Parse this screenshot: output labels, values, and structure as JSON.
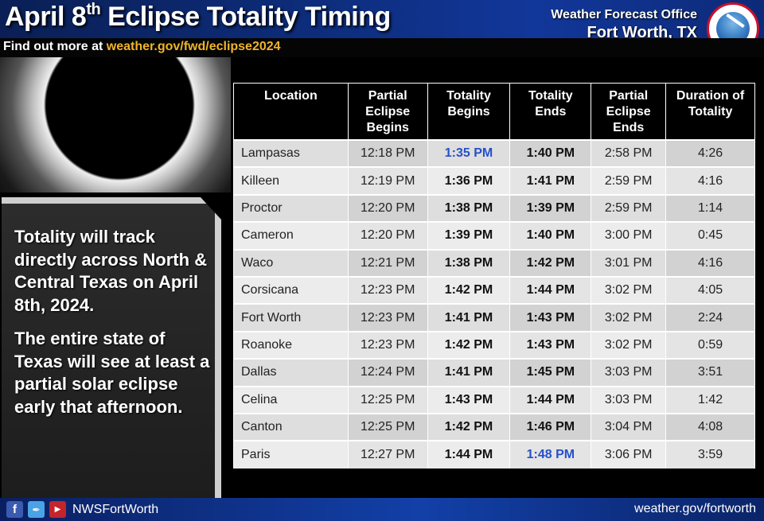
{
  "header": {
    "title_pre": "April 8",
    "title_sup": "th",
    "title_post": " Eclipse Totality Timing",
    "subtitle_prefix": "Find out more at ",
    "subtitle_link": "weather.gov/fwd/eclipse2024",
    "office_line1": "Weather Forecast Office",
    "office_line2": "Fort Worth, TX",
    "logo_icon": "nws-logo-icon"
  },
  "info_panel": {
    "paragraph1": "Totality will track directly across North & Central Texas on April 8th, 2024.",
    "paragraph2": "The entire state of Texas will see at least a partial solar eclipse early that afternoon."
  },
  "table": {
    "columns": [
      "Location",
      "Partial Eclipse Begins",
      "Totality Begins",
      "Totality Ends",
      "Partial Eclipse Ends",
      "Duration of Totality"
    ],
    "highlight_color": "#2550c8",
    "rows": [
      {
        "location": "Lampasas",
        "partial_begins": "12:18 PM",
        "totality_begins": "1:35 PM",
        "totality_ends": "1:40 PM",
        "partial_ends": "2:58 PM",
        "duration": "4:26"
      },
      {
        "location": "Killeen",
        "partial_begins": "12:19 PM",
        "totality_begins": "1:36 PM",
        "totality_ends": "1:41 PM",
        "partial_ends": "2:59 PM",
        "duration": "4:16"
      },
      {
        "location": "Proctor",
        "partial_begins": "12:20 PM",
        "totality_begins": "1:38 PM",
        "totality_ends": "1:39 PM",
        "partial_ends": "2:59 PM",
        "duration": "1:14"
      },
      {
        "location": "Cameron",
        "partial_begins": "12:20 PM",
        "totality_begins": "1:39 PM",
        "totality_ends": "1:40 PM",
        "partial_ends": "3:00 PM",
        "duration": "0:45"
      },
      {
        "location": "Waco",
        "partial_begins": "12:21 PM",
        "totality_begins": "1:38 PM",
        "totality_ends": "1:42 PM",
        "partial_ends": "3:01 PM",
        "duration": "4:16"
      },
      {
        "location": "Corsicana",
        "partial_begins": "12:23 PM",
        "totality_begins": "1:42 PM",
        "totality_ends": "1:44 PM",
        "partial_ends": "3:02 PM",
        "duration": "4:05"
      },
      {
        "location": "Fort Worth",
        "partial_begins": "12:23 PM",
        "totality_begins": "1:41 PM",
        "totality_ends": "1:43 PM",
        "partial_ends": "3:02 PM",
        "duration": "2:24"
      },
      {
        "location": "Roanoke",
        "partial_begins": "12:23 PM",
        "totality_begins": "1:42 PM",
        "totality_ends": "1:43 PM",
        "partial_ends": "3:02 PM",
        "duration": "0:59"
      },
      {
        "location": "Dallas",
        "partial_begins": "12:24 PM",
        "totality_begins": "1:41 PM",
        "totality_ends": "1:45 PM",
        "partial_ends": "3:03 PM",
        "duration": "3:51"
      },
      {
        "location": "Celina",
        "partial_begins": "12:25 PM",
        "totality_begins": "1:43 PM",
        "totality_ends": "1:44 PM",
        "partial_ends": "3:03 PM",
        "duration": "1:42"
      },
      {
        "location": "Canton",
        "partial_begins": "12:25 PM",
        "totality_begins": "1:42 PM",
        "totality_ends": "1:46 PM",
        "partial_ends": "3:04 PM",
        "duration": "4:08"
      },
      {
        "location": "Paris",
        "partial_begins": "12:27 PM",
        "totality_begins": "1:44 PM",
        "totality_ends": "1:48 PM",
        "partial_ends": "3:06 PM",
        "duration": "3:59"
      }
    ],
    "highlighted_cells": [
      {
        "row": 0,
        "column": "totality_begins",
        "meaning": "earliest totality begins"
      },
      {
        "row": 11,
        "column": "totality_ends",
        "meaning": "latest totality ends"
      }
    ]
  },
  "footer": {
    "social_icons": [
      {
        "icon": "facebook-icon",
        "glyph": "f"
      },
      {
        "icon": "twitter-icon",
        "glyph": "✒"
      },
      {
        "icon": "youtube-icon",
        "glyph": "▶"
      }
    ],
    "handle": "NWSFortWorth",
    "website": "weather.gov/fortworth"
  }
}
